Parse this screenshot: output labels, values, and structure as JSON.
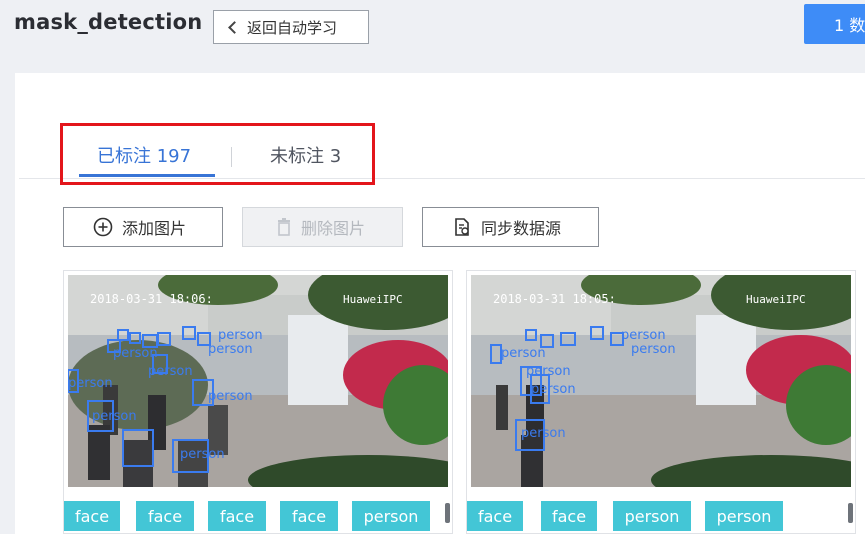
{
  "header": {
    "title": "mask_detection",
    "back_label": "返回自动学习",
    "primary_label": "1 数"
  },
  "tabs": [
    {
      "label": "已标注 197",
      "active": true
    },
    {
      "label": "未标注 3",
      "active": false
    }
  ],
  "toolbar": {
    "add_label": "添加图片",
    "delete_label": "删除图片",
    "sync_label": "同步数据源"
  },
  "images": [
    {
      "timestamp": "2018-03-31 18:06:",
      "camera": "HuaweiIPC",
      "box_label": "person",
      "tags": [
        "face",
        "face",
        "face",
        "face",
        "person"
      ]
    },
    {
      "timestamp": "2018-03-31 18:05:",
      "camera": "HuaweiIPC",
      "box_label": "person",
      "tags": [
        "face",
        "face",
        "person",
        "person"
      ]
    }
  ],
  "colors": {
    "accent": "#3874d6",
    "primary_button": "#3e8cf7",
    "tag": "#43c6d6",
    "highlight": "#e3151b",
    "bbox": "#3a7bef"
  }
}
